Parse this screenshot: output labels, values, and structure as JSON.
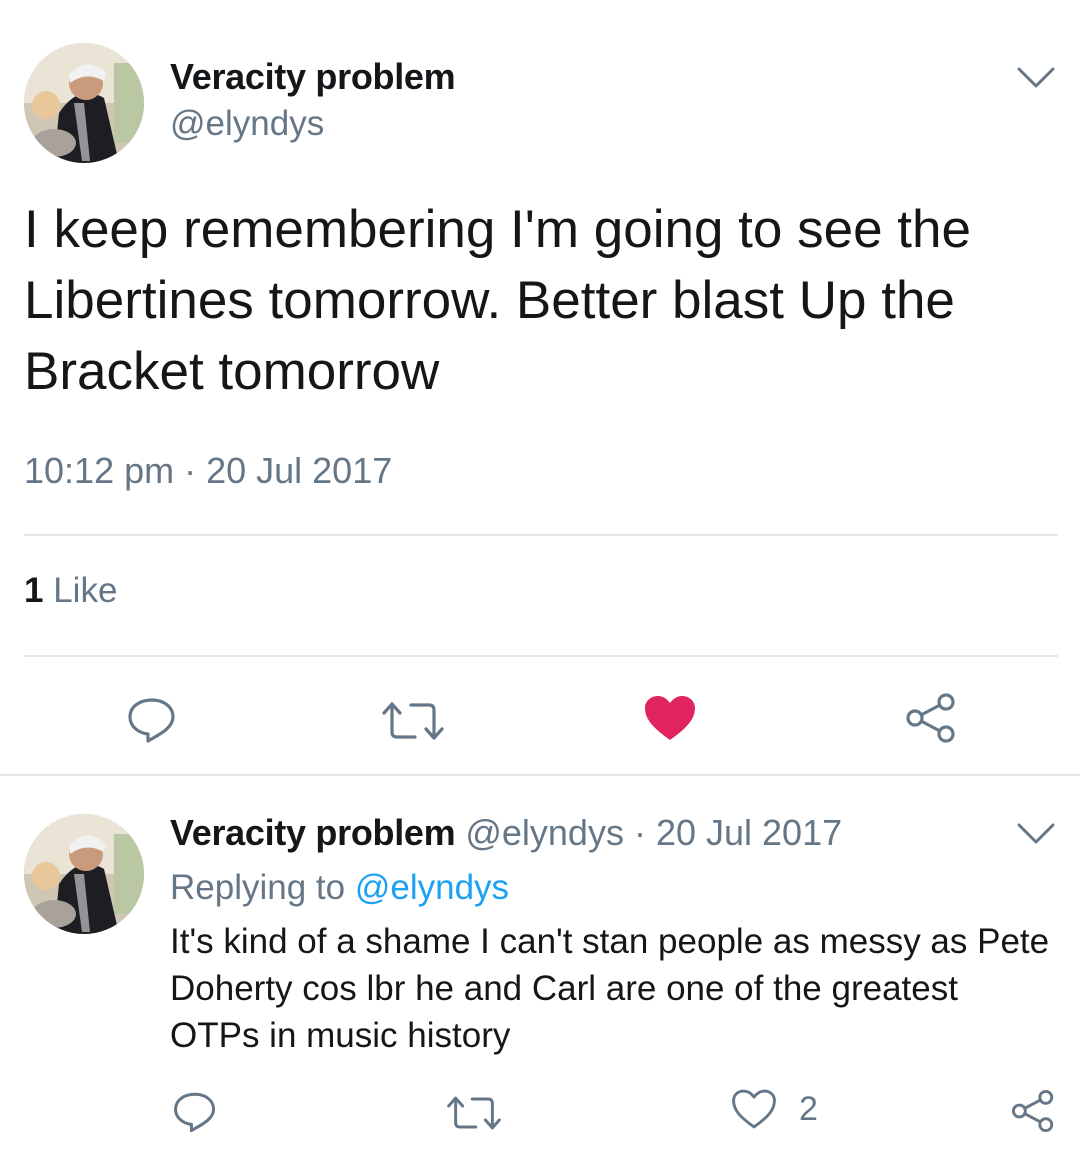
{
  "main_tweet": {
    "author_name": "Veracity problem",
    "author_handle": "@elyndys",
    "text": "I keep remembering I'm going to see the Libertines tomorrow. Better blast Up the Bracket tomorrow",
    "timestamp": "10:12 pm · 20 Jul 2017",
    "like_count": "1",
    "like_label": "Like",
    "liked": true,
    "icons": {
      "more": "chevron-down-icon",
      "reply": "reply-icon",
      "retweet": "retweet-icon",
      "like": "heart-filled-icon",
      "share": "share-icon"
    }
  },
  "reply_tweet": {
    "author_name": "Veracity problem",
    "author_handle": "@elyndys",
    "date": "· 20 Jul 2017",
    "replying_prefix": "Replying to",
    "replying_to": "@elyndys",
    "text": "It's kind of a shame I can't stan people as messy as Pete Doherty cos lbr he and Carl are one of the greatest OTPs in music history",
    "like_count": "2",
    "icons": {
      "more": "chevron-down-icon",
      "reply": "reply-icon",
      "retweet": "retweet-icon",
      "like": "heart-outline-icon",
      "share": "share-icon"
    }
  },
  "colors": {
    "text": "#14171a",
    "secondary": "#657786",
    "link": "#1da1f2",
    "like_active": "#e0245e",
    "divider": "#e1e8ed"
  }
}
